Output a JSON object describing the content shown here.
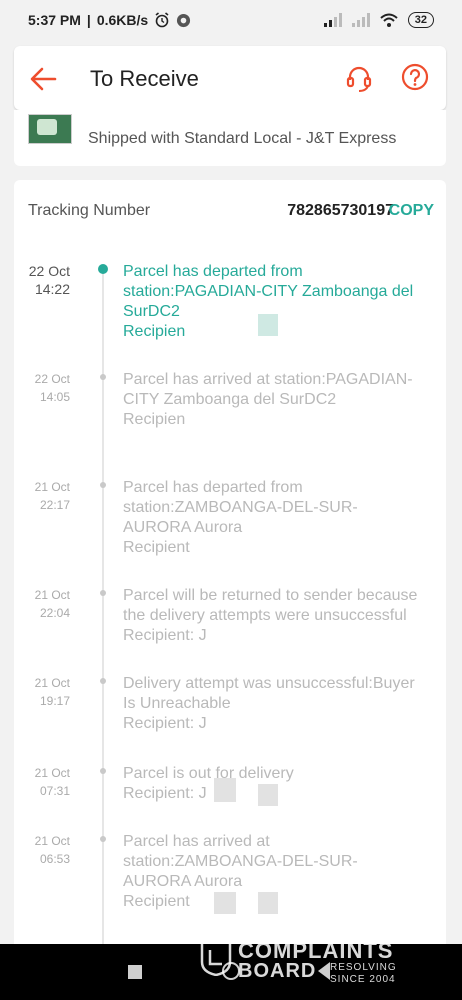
{
  "status_bar": {
    "time": "5:37 PM",
    "speed": "0.6KB/s",
    "battery": "32"
  },
  "header": {
    "title": "To Receive"
  },
  "shipping": {
    "method": "Shipped with Standard Local - J&T Express"
  },
  "tracking": {
    "label": "Tracking Number",
    "number": "782865730197",
    "copy_label": "COPY"
  },
  "events": [
    {
      "date": "22 Oct",
      "time": "14:22",
      "text": "Parcel has departed from station:PAGADIAN-CITY Zamboanga del SurDC2",
      "recipient": "Recipien"
    },
    {
      "date": "22 Oct",
      "time": "14:05",
      "text": "Parcel has arrived at station:PAGADIAN-CITY Zamboanga del SurDC2",
      "recipient": "Recipien"
    },
    {
      "date": "21 Oct",
      "time": "22:17",
      "text": "Parcel has departed from station:ZAMBOANGA-DEL-SUR-AURORA Aurora",
      "recipient": "Recipient"
    },
    {
      "date": "21 Oct",
      "time": "22:04",
      "text": "Parcel will be returned to sender because the delivery attempts were unsuccessful",
      "recipient": "Recipient: J"
    },
    {
      "date": "21 Oct",
      "time": "19:17",
      "text": "Delivery attempt was unsuccessful:Buyer Is Unreachable",
      "recipient": "Recipient: J"
    },
    {
      "date": "21 Oct",
      "time": "07:31",
      "text": "Parcel is out for delivery",
      "recipient": "Recipient: J"
    },
    {
      "date": "21 Oct",
      "time": "06:53",
      "text": "Parcel has arrived at station:ZAMBOANGA-DEL-SUR-AURORA Aurora",
      "recipient": "Recipient"
    }
  ],
  "watermark": {
    "line1": "COMPLAINTS",
    "line2": "BOARD",
    "sub1": "RESOLVING",
    "sub2": "SINCE 2004"
  },
  "colors": {
    "accent": "#26aa99",
    "brand_orange": "#ee4d2d"
  }
}
